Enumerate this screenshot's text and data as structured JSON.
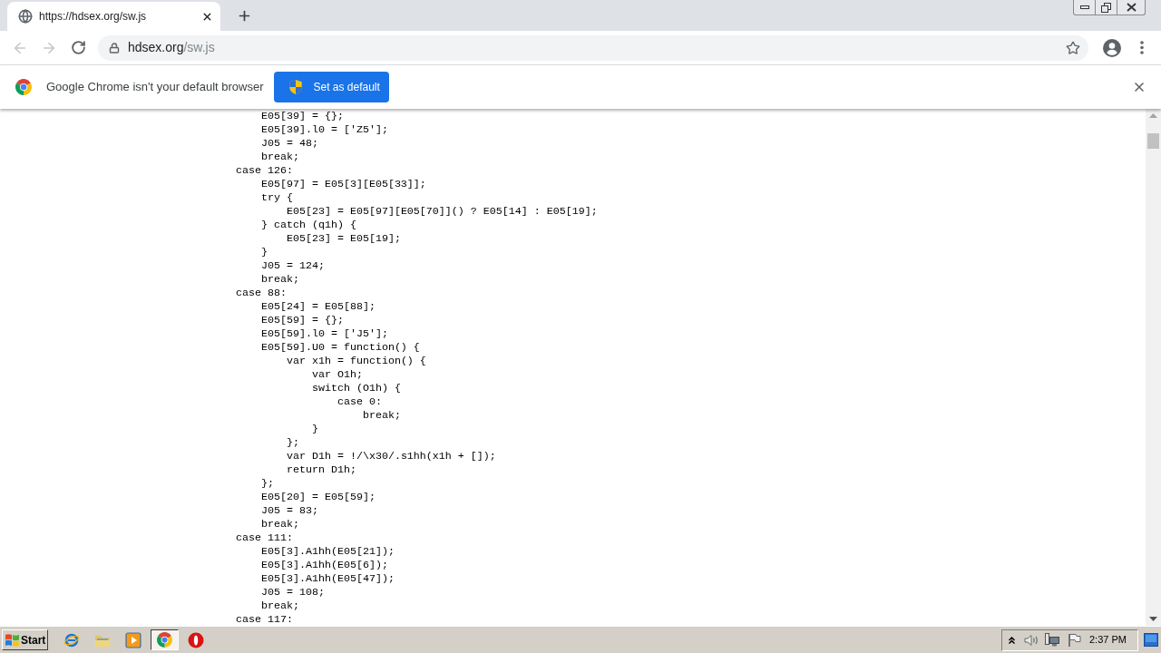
{
  "browser": {
    "tabs": [
      {
        "title": "https://hdsex.org/sw.js",
        "selected": true
      }
    ],
    "toolbar": {
      "back": {
        "disabled": true
      },
      "forward": {
        "disabled": true
      },
      "address_bar": {
        "host": "hdsex.org",
        "path": "/sw.js"
      }
    },
    "infobar": {
      "message": "Google Chrome isn't your default browser",
      "button": "Set as default"
    }
  },
  "page": {
    "code_lines": [
      "    E05[39] = {};",
      "    E05[39].l0 = ['Z5'];",
      "    J05 = 48;",
      "    break;",
      "case 126:",
      "    E05[97] = E05[3][E05[33]];",
      "    try {",
      "        E05[23] = E05[97][E05[70]]() ? E05[14] : E05[19];",
      "    } catch (q1h) {",
      "        E05[23] = E05[19];",
      "    }",
      "    J05 = 124;",
      "    break;",
      "case 88:",
      "    E05[24] = E05[88];",
      "    E05[59] = {};",
      "    E05[59].l0 = ['J5'];",
      "    E05[59].U0 = function() {",
      "        var x1h = function() {",
      "            var O1h;",
      "            switch (O1h) {",
      "                case 0:",
      "                    break;",
      "            }",
      "        };",
      "        var D1h = !/\\x30/.s1hh(x1h + []);",
      "        return D1h;",
      "    };",
      "    E05[20] = E05[59];",
      "    J05 = 83;",
      "    break;",
      "case 111:",
      "    E05[3].A1hh(E05[21]);",
      "    E05[3].A1hh(E05[6]);",
      "    E05[3].A1hh(E05[47]);",
      "    J05 = 108;",
      "    break;",
      "case 117:"
    ]
  },
  "taskbar": {
    "start": "Start",
    "apps": [
      {
        "kind": "orbit-e",
        "active": false
      },
      {
        "kind": "folder",
        "active": false
      },
      {
        "kind": "media",
        "active": false
      },
      {
        "kind": "chrome",
        "active": true
      },
      {
        "kind": "ring",
        "active": false
      }
    ],
    "clock": "2:37 PM"
  }
}
